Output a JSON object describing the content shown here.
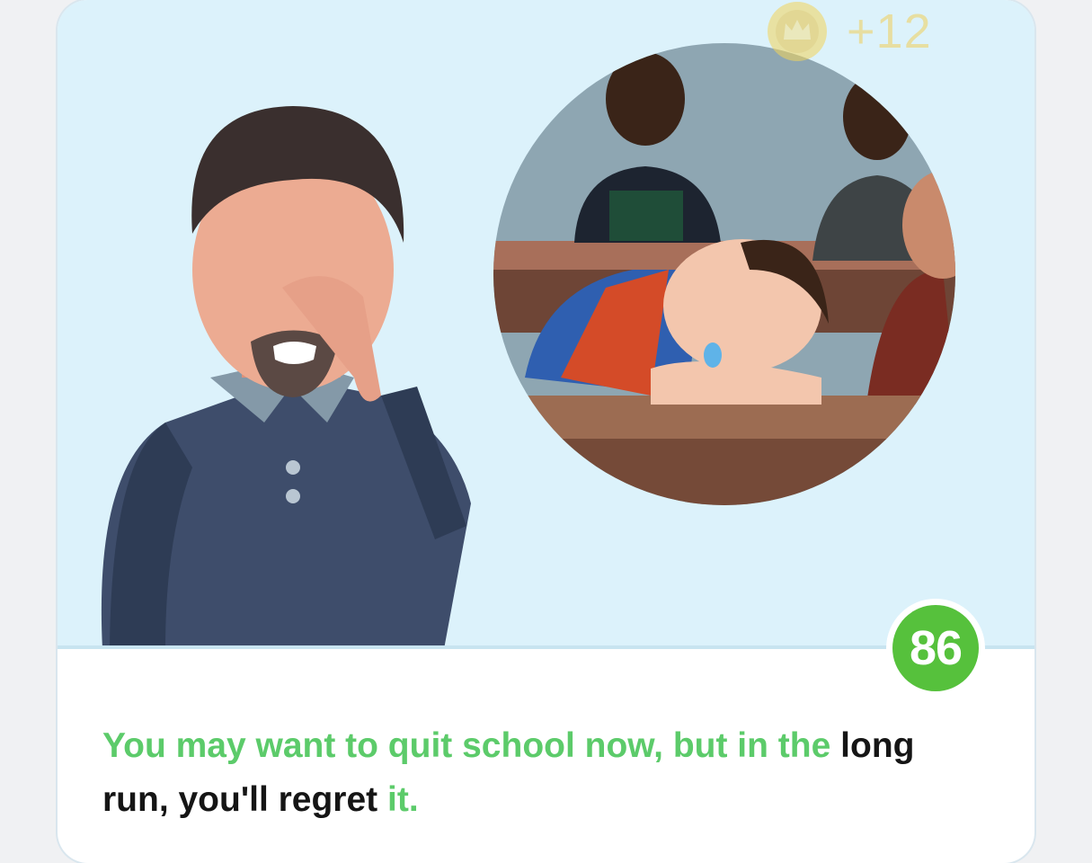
{
  "reward": {
    "coin_icon": "crown-coin-icon",
    "amount": "+12"
  },
  "score": {
    "value": "86",
    "color": "#56c13c"
  },
  "sentence": {
    "part1": "You may want to quit school now, but in the",
    "part2": "long run, you'll regret",
    "part3": "it.",
    "highlight_color": "#5ccb6a"
  }
}
